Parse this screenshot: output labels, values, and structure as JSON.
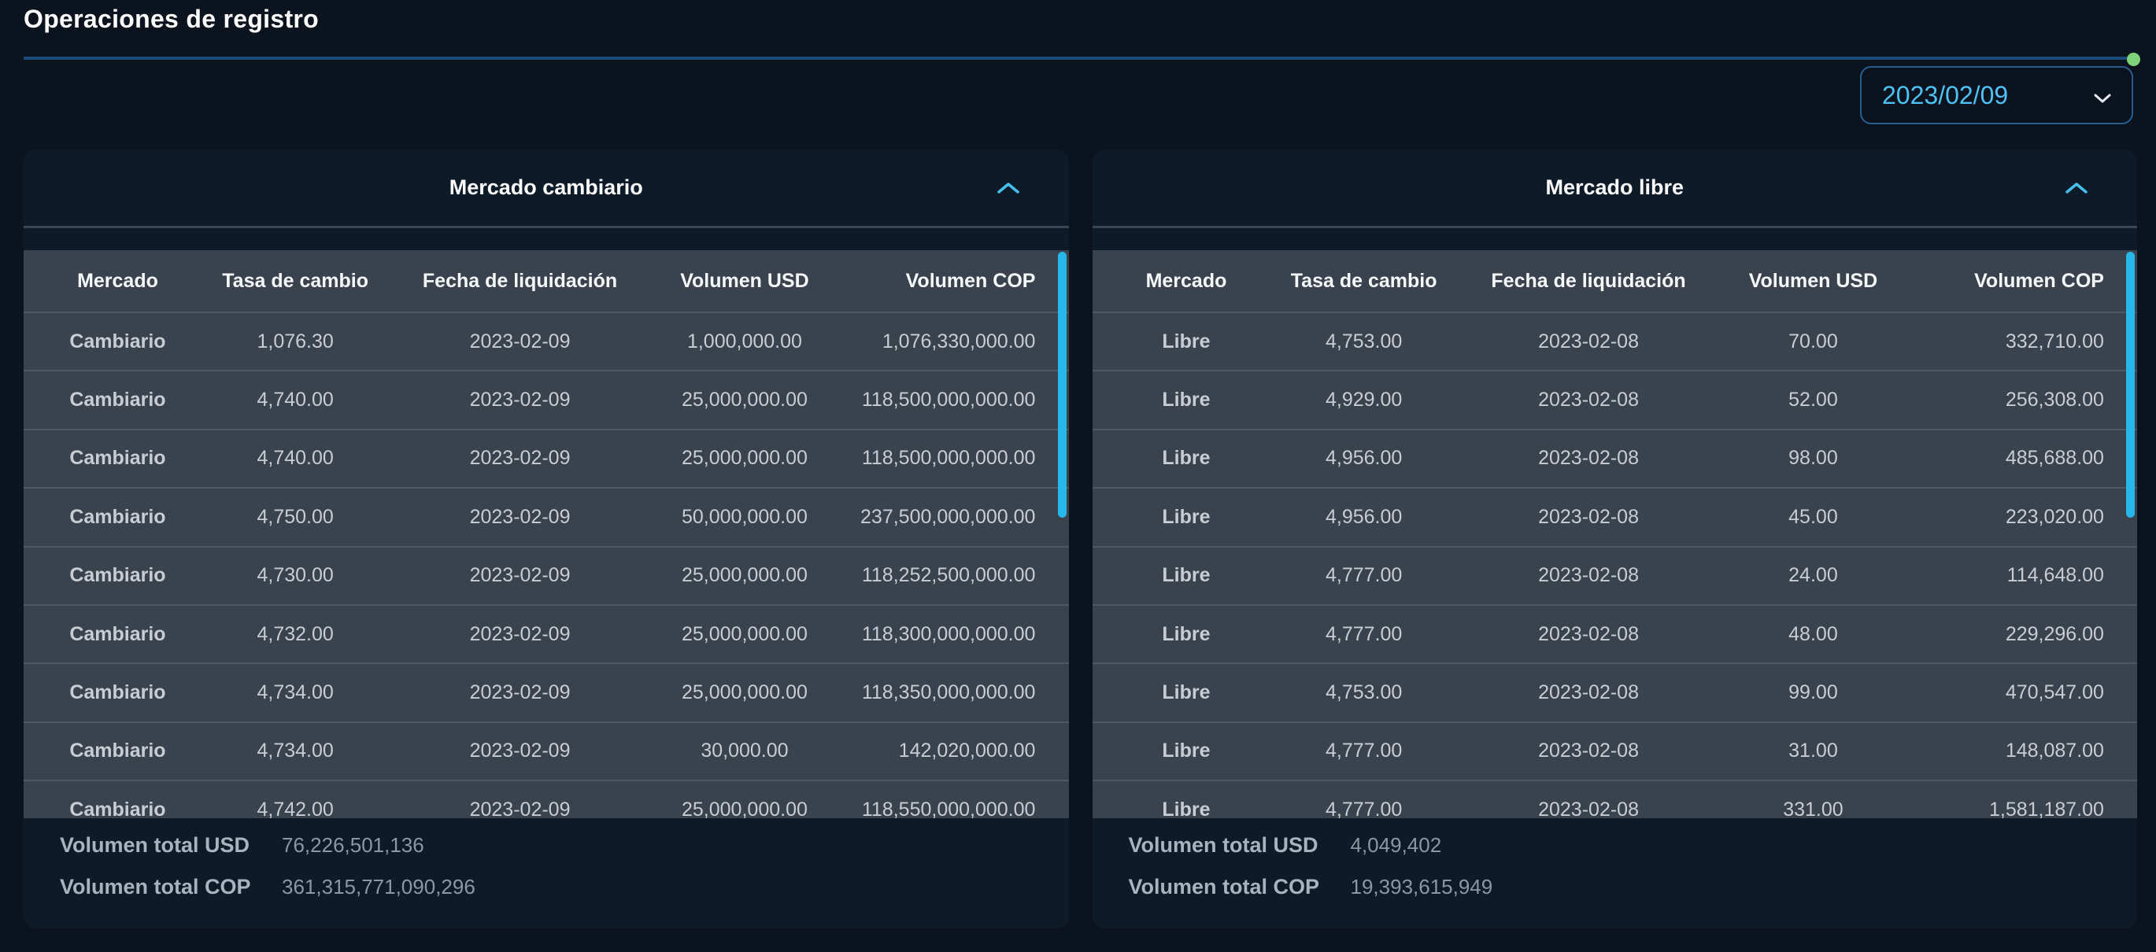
{
  "header": {
    "title": "Operaciones de registro",
    "date_select": {
      "value": "2023/02/09"
    }
  },
  "columns": [
    "Mercado",
    "Tasa de cambio",
    "Fecha de liquidación",
    "Volumen USD",
    "Volumen COP"
  ],
  "cards": [
    {
      "title": "Mercado cambiario",
      "rows": [
        [
          "Cambiario",
          "1,076.30",
          "2023-02-09",
          "1,000,000.00",
          "1,076,330,000.00"
        ],
        [
          "Cambiario",
          "4,740.00",
          "2023-02-09",
          "25,000,000.00",
          "118,500,000,000.00"
        ],
        [
          "Cambiario",
          "4,740.00",
          "2023-02-09",
          "25,000,000.00",
          "118,500,000,000.00"
        ],
        [
          "Cambiario",
          "4,750.00",
          "2023-02-09",
          "50,000,000.00",
          "237,500,000,000.00"
        ],
        [
          "Cambiario",
          "4,730.00",
          "2023-02-09",
          "25,000,000.00",
          "118,252,500,000.00"
        ],
        [
          "Cambiario",
          "4,732.00",
          "2023-02-09",
          "25,000,000.00",
          "118,300,000,000.00"
        ],
        [
          "Cambiario",
          "4,734.00",
          "2023-02-09",
          "25,000,000.00",
          "118,350,000,000.00"
        ],
        [
          "Cambiario",
          "4,734.00",
          "2023-02-09",
          "30,000.00",
          "142,020,000.00"
        ],
        [
          "Cambiario",
          "4,742.00",
          "2023-02-09",
          "25,000,000.00",
          "118,550,000,000.00"
        ]
      ],
      "totals": [
        {
          "label": "Volumen total USD",
          "value": "76,226,501,136"
        },
        {
          "label": "Volumen total COP",
          "value": "361,315,771,090,296"
        }
      ]
    },
    {
      "title": "Mercado libre",
      "rows": [
        [
          "Libre",
          "4,753.00",
          "2023-02-08",
          "70.00",
          "332,710.00"
        ],
        [
          "Libre",
          "4,929.00",
          "2023-02-08",
          "52.00",
          "256,308.00"
        ],
        [
          "Libre",
          "4,956.00",
          "2023-02-08",
          "98.00",
          "485,688.00"
        ],
        [
          "Libre",
          "4,956.00",
          "2023-02-08",
          "45.00",
          "223,020.00"
        ],
        [
          "Libre",
          "4,777.00",
          "2023-02-08",
          "24.00",
          "114,648.00"
        ],
        [
          "Libre",
          "4,777.00",
          "2023-02-08",
          "48.00",
          "229,296.00"
        ],
        [
          "Libre",
          "4,753.00",
          "2023-02-08",
          "99.00",
          "470,547.00"
        ],
        [
          "Libre",
          "4,777.00",
          "2023-02-08",
          "31.00",
          "148,087.00"
        ],
        [
          "Libre",
          "4,777.00",
          "2023-02-08",
          "331.00",
          "1,581,187.00"
        ]
      ],
      "totals": [
        {
          "label": "Volumen total USD",
          "value": "4,049,402"
        },
        {
          "label": "Volumen total COP",
          "value": "19,393,615,949"
        }
      ]
    }
  ],
  "colors": {
    "page_bg": "#0a131e",
    "card_bg": "#0d1b29",
    "row_bg": "#39424d",
    "scrollbar_cyan": "#28b7ea",
    "chevron_blue": "#46c0f0",
    "date_text_blue": "#4ec2f5",
    "date_border_blue": "#275e92",
    "underline_blue": "#1b4c7c",
    "status_green": "#7ed37a"
  }
}
